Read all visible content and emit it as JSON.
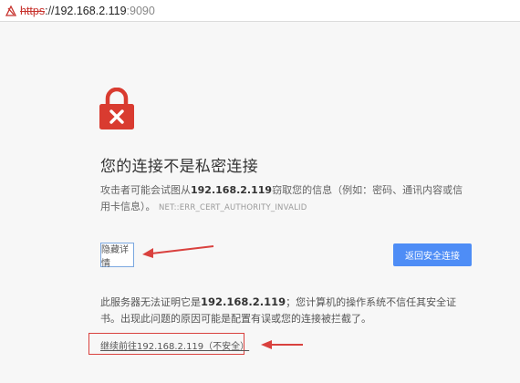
{
  "address_bar": {
    "scheme": "https",
    "separator": "://",
    "host": "192.168.2.119",
    "port": ":9090",
    "warning_icon": "not-secure-icon"
  },
  "lock_icon": "lock-error-icon",
  "colors": {
    "lock_red": "#d93b30",
    "primary_button": "#4e8df6",
    "annotation_red": "#d9413e"
  },
  "heading": "您的连接不是私密连接",
  "description": {
    "prefix": "攻击者可能会试图从",
    "host": "192.168.2.119",
    "suffix": "窃取您的信息（例如：密码、通讯内容或信用卡信息）。",
    "error_code": "NET::ERR_CERT_AUTHORITY_INVALID"
  },
  "buttons": {
    "hide_details": "隐藏详情",
    "back_to_safety": "返回安全连接"
  },
  "explanation": {
    "prefix": "此服务器无法证明它是",
    "host": "192.168.2.119",
    "suffix": "；您计算机的操作系统不信任其安全证书。出现此问题的原因可能是配置有误或您的连接被拦截了。"
  },
  "proceed_link": "继续前往192.168.2.119（不安全）"
}
